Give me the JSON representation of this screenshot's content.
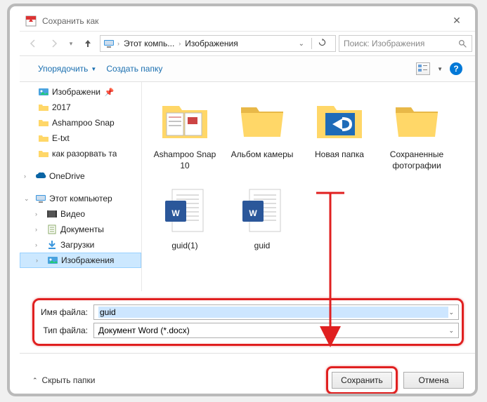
{
  "title": "Сохранить как",
  "breadcrumb": {
    "pc": "Этот компь...",
    "folder": "Изображения"
  },
  "search_placeholder": "Поиск: Изображения",
  "cmd": {
    "organize": "Упорядочить",
    "newfolder": "Создать папку"
  },
  "tree": {
    "quick": [
      {
        "label": "Изображени",
        "pin": true,
        "icon": "pictures"
      },
      {
        "label": "2017",
        "icon": "folder"
      },
      {
        "label": "Ashampoo Snap",
        "icon": "folder"
      },
      {
        "label": "E-txt",
        "icon": "folder"
      },
      {
        "label": "как разорвать та",
        "icon": "folder"
      }
    ],
    "onedrive": "OneDrive",
    "thispc": "Этот компьютер",
    "pc_items": [
      {
        "label": "Видео",
        "icon": "video"
      },
      {
        "label": "Документы",
        "icon": "docs"
      },
      {
        "label": "Загрузки",
        "icon": "downloads"
      },
      {
        "label": "Изображения",
        "icon": "pictures",
        "sel": true
      }
    ]
  },
  "items": [
    {
      "label": "Ashampoo Snap 10",
      "kind": "folder-thumb"
    },
    {
      "label": "Альбом камеры",
      "kind": "folder"
    },
    {
      "label": "Новая папка",
      "kind": "folder-blue"
    },
    {
      "label": "Сохраненные фотографии",
      "kind": "folder"
    },
    {
      "label": "guid(1)",
      "kind": "word"
    },
    {
      "label": "guid",
      "kind": "word"
    }
  ],
  "fields": {
    "filename_label": "Имя файла:",
    "filename_value": "guid",
    "filetype_label": "Тип файла:",
    "filetype_value": "Документ Word (*.docx)"
  },
  "footer": {
    "hide": "Скрыть папки",
    "save": "Сохранить",
    "cancel": "Отмена"
  }
}
